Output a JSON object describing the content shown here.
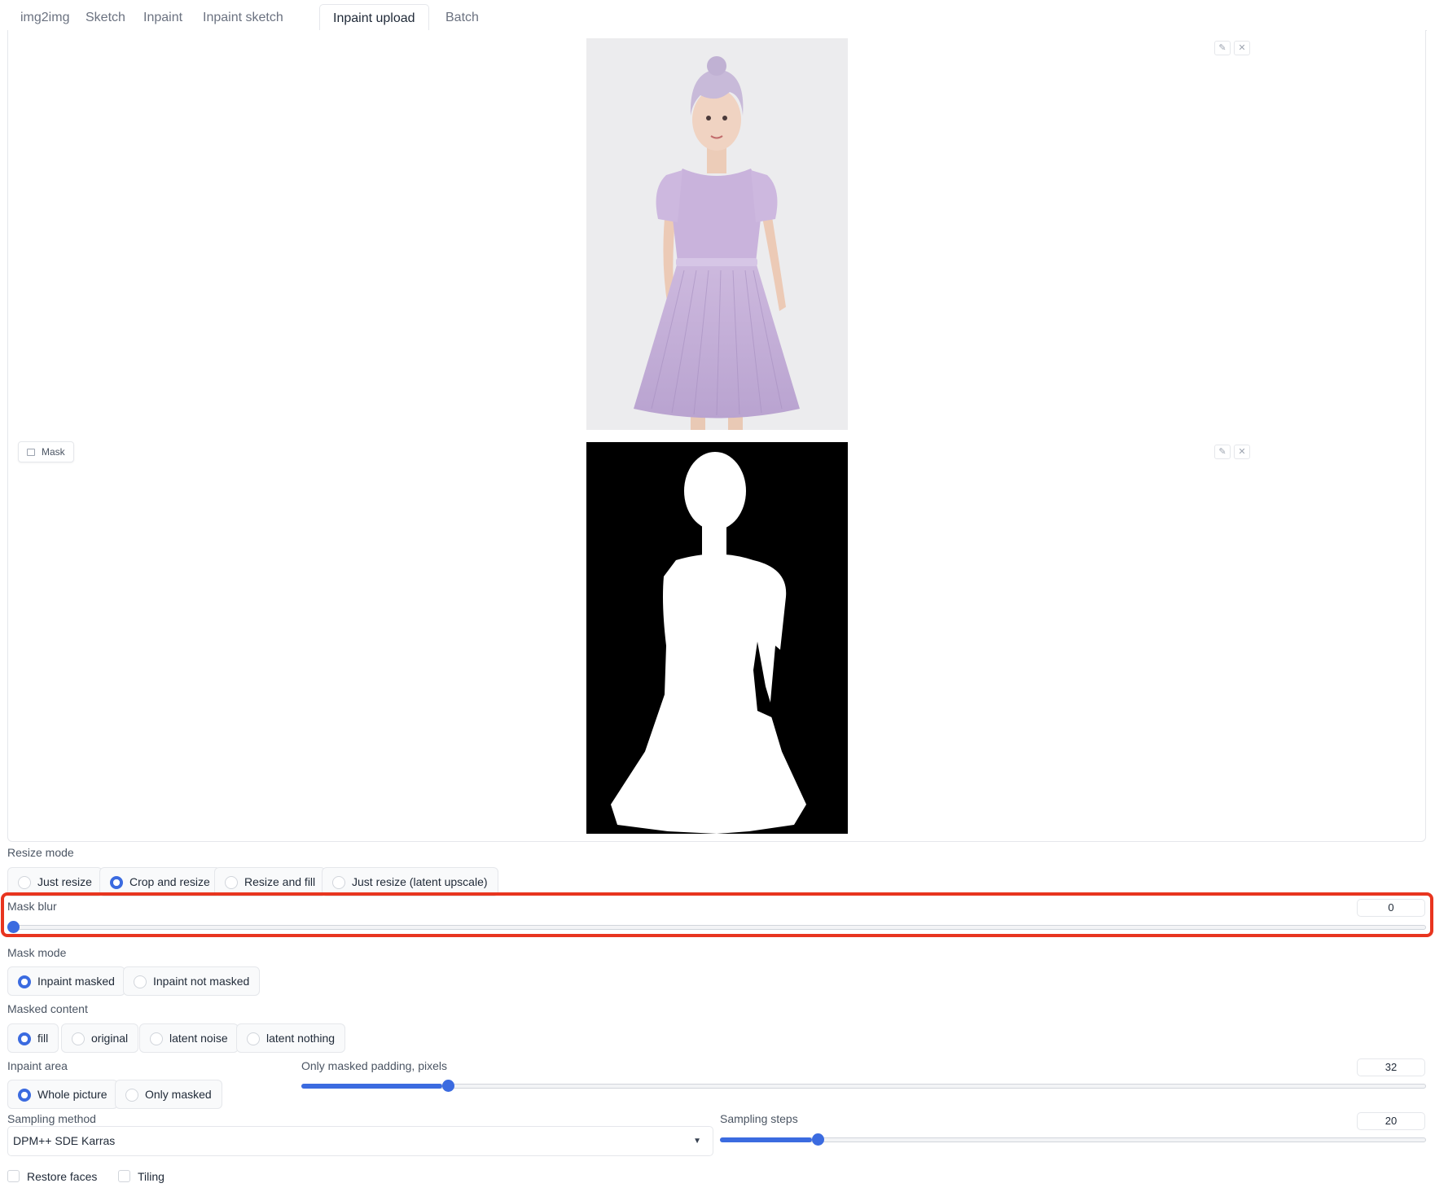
{
  "tabs": [
    {
      "label": "img2img",
      "active": false
    },
    {
      "label": "Sketch",
      "active": false
    },
    {
      "label": "Inpaint",
      "active": false
    },
    {
      "label": "Inpaint sketch",
      "active": false
    },
    {
      "label": "Inpaint upload",
      "active": true
    },
    {
      "label": "Batch",
      "active": false
    }
  ],
  "image_panel": {
    "mask_label": "Mask",
    "icons": [
      "pencil-icon",
      "close-icon",
      "image-icon"
    ]
  },
  "resize_mode": {
    "label": "Resize mode",
    "options": [
      "Just resize",
      "Crop and resize",
      "Resize and fill",
      "Just resize (latent upscale)"
    ],
    "selected": "Crop and resize"
  },
  "mask_blur": {
    "label": "Mask blur",
    "value": "0",
    "fraction": 0.0
  },
  "mask_mode": {
    "label": "Mask mode",
    "options": [
      "Inpaint masked",
      "Inpaint not masked"
    ],
    "selected": "Inpaint masked"
  },
  "masked_content": {
    "label": "Masked content",
    "options": [
      "fill",
      "original",
      "latent noise",
      "latent nothing"
    ],
    "selected": "fill"
  },
  "inpaint_area": {
    "label": "Inpaint area",
    "options": [
      "Whole picture",
      "Only masked"
    ],
    "selected": "Whole picture"
  },
  "only_masked_padding": {
    "label": "Only masked padding, pixels",
    "value": "32",
    "fraction": 0.125
  },
  "sampling_method": {
    "label": "Sampling method",
    "value": "DPM++ SDE Karras"
  },
  "sampling_steps": {
    "label": "Sampling steps",
    "value": "20",
    "fraction": 0.13
  },
  "checkboxes": {
    "restore_faces": "Restore faces",
    "tiling": "Tiling"
  },
  "colors": {
    "accent": "#3b6be0",
    "highlight": "#e8351f",
    "dress": "#c6b2d9"
  }
}
